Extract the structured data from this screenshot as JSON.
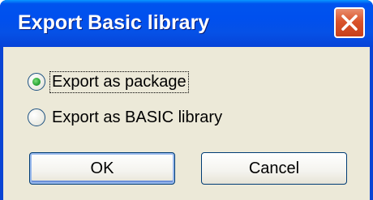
{
  "window": {
    "title": "Export Basic library",
    "close_label": "Close"
  },
  "options": {
    "items": [
      {
        "label": "Export as package",
        "selected": true
      },
      {
        "label": "Export as BASIC library",
        "selected": false
      }
    ]
  },
  "buttons": {
    "ok_label": "OK",
    "cancel_label": "Cancel"
  },
  "colors": {
    "titlebar": "#0053EE",
    "dialog_bg": "#ECE9D8",
    "close_button": "#D9542C",
    "radio_selected": "#2FA83A"
  }
}
